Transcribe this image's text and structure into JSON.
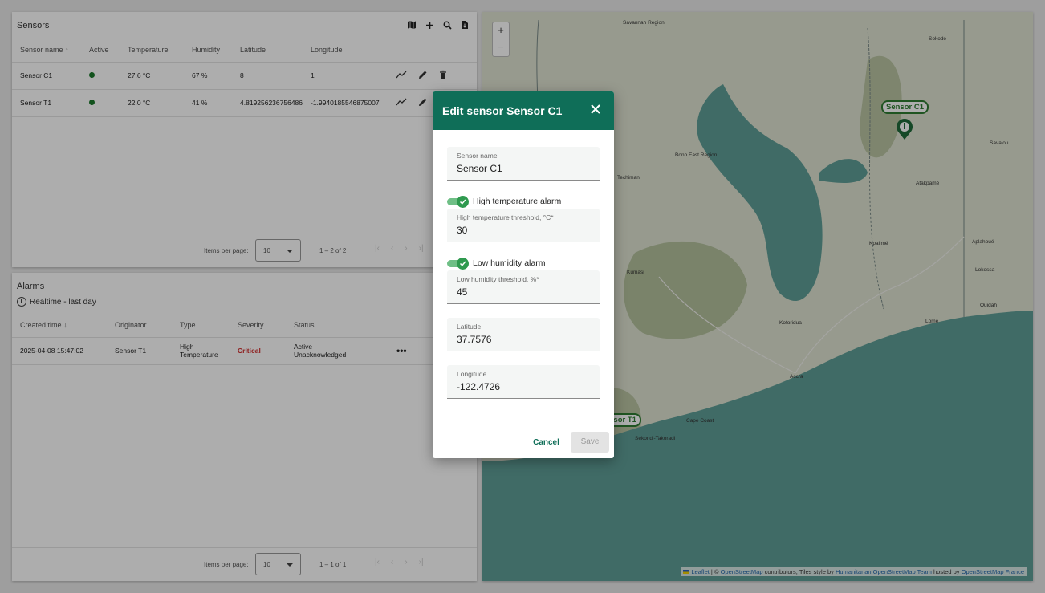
{
  "sensors": {
    "title": "Sensors",
    "columns": [
      "Sensor name",
      "Active",
      "Temperature",
      "Humidity",
      "Latitude",
      "Longitude"
    ],
    "rows": [
      {
        "name": "Sensor C1",
        "temperature": "27.6 °C",
        "humidity": "67 %",
        "latitude": "8",
        "longitude": "1"
      },
      {
        "name": "Sensor T1",
        "temperature": "22.0 °C",
        "humidity": "41 %",
        "latitude": "4.819256236756486",
        "longitude": "-1.9940185546875007"
      }
    ],
    "paginator": {
      "label": "Items per page:",
      "value": "10",
      "range": "1 – 2 of 2"
    }
  },
  "alarms": {
    "title": "Alarms",
    "filter": "Realtime - last day",
    "columns": [
      "Created time",
      "Originator",
      "Type",
      "Severity",
      "Status"
    ],
    "rows": [
      {
        "created": "2025-04-08 15:47:02",
        "originator": "Sensor T1",
        "type_line1": "High",
        "type_line2": "Temperature",
        "severity": "Critical",
        "status_line1": "Active",
        "status_line2": "Unacknowledged"
      }
    ],
    "paginator": {
      "label": "Items per page:",
      "value": "10",
      "range": "1 – 1 of 1"
    }
  },
  "map": {
    "zoom_in": "+",
    "zoom_out": "−",
    "markers": [
      "Sensor C1",
      "Sensor T1"
    ],
    "places": [
      "Savannah Region",
      "Sokodé",
      "Bono East Region",
      "Techiman",
      "Atakpamé",
      "Kpalimé",
      "Aplahoué",
      "Kumasi",
      "Koforidua",
      "Accra",
      "Lomé",
      "Cape Coast",
      "Sekondi-Takoradi",
      "Ouidah",
      "Lokossa",
      "Savalou"
    ],
    "attribution": {
      "leaflet": "Leaflet",
      "sep": " | © ",
      "osm": "OpenStreetMap",
      "mid": " contributors, Tiles style by ",
      "hot": "Humanitarian OpenStreetMap Team",
      "hosted": " hosted by ",
      "osmfr": "OpenStreetMap France"
    },
    "colors": {
      "water": "#5f9e97",
      "land": "#dfe4d2",
      "forest": "#a9b88e"
    }
  },
  "dialog": {
    "title": "Edit sensor Sensor C1",
    "sensor_name_label": "Sensor name",
    "sensor_name_value": "Sensor C1",
    "high_temp_toggle": "High temperature alarm",
    "high_temp_label": "High temperature threshold, °C*",
    "high_temp_value": "30",
    "low_hum_toggle": "Low humidity alarm",
    "low_hum_label": "Low humidity threshold, %*",
    "low_hum_value": "45",
    "latitude_label": "Latitude",
    "latitude_value": "37.7576",
    "longitude_label": "Longitude",
    "longitude_value": "-122.4726",
    "cancel": "Cancel",
    "save": "Save",
    "accent": "#0f6e58"
  }
}
